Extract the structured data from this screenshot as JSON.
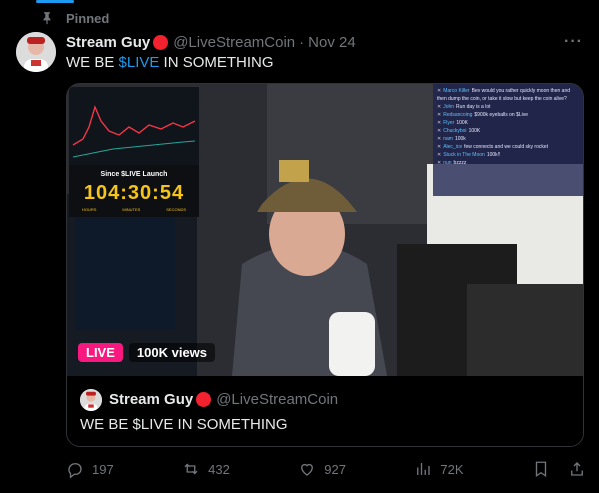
{
  "pinned": {
    "label": "Pinned"
  },
  "author": {
    "name": "Stream Guy",
    "handle": "@LiveStreamCoin",
    "separator": "·",
    "date": "Nov 24",
    "more": "···"
  },
  "tweet": {
    "text_prefix": "WE BE ",
    "cashtag": "$LIVE",
    "text_suffix": " IN SOMETHING"
  },
  "media": {
    "live_label": "LIVE",
    "views_label": "100K views",
    "overlay": {
      "since_label": "Since $LIVE Launch",
      "timer": "104:30:54",
      "timer_units": [
        "HOURS",
        "MINUTES",
        "SECONDS"
      ]
    },
    "chat": [
      {
        "user": "Marco Killer",
        "text": "Bev would you rather quickly moon then and then dump the coin, or take it slow but keep the coin alive?"
      },
      {
        "user": "John",
        "text": "Run day is a lot"
      },
      {
        "user": "Redsancoing",
        "text": "$900k eyeballs on $Live"
      },
      {
        "user": "Flyer",
        "text": "100K"
      },
      {
        "user": "Chuckyboi",
        "text": "100K"
      },
      {
        "user": "nam",
        "text": "100k"
      },
      {
        "user": "Alec_ice",
        "text": "few connects and we could sky rocket"
      },
      {
        "user": "Stuck in The Moon",
        "text": "100k!!"
      },
      {
        "user": "nun",
        "text": "bzzzz"
      }
    ]
  },
  "quote": {
    "name": "Stream Guy",
    "handle": "@LiveStreamCoin",
    "text": "WE BE $LIVE IN SOMETHING"
  },
  "stats": {
    "replies": "197",
    "reposts": "432",
    "likes": "927",
    "views": "72K"
  },
  "icons": {
    "pin": "pin-icon",
    "reply": "reply-icon",
    "repost": "repost-icon",
    "like": "heart-icon",
    "views": "views-icon",
    "bookmark": "bookmark-icon",
    "share": "share-icon"
  },
  "colors": {
    "accent": "#1d9bf0",
    "live": "#f91880",
    "badge": "#f4212e",
    "timer": "#f5c518",
    "secondary_text": "#71767b"
  }
}
